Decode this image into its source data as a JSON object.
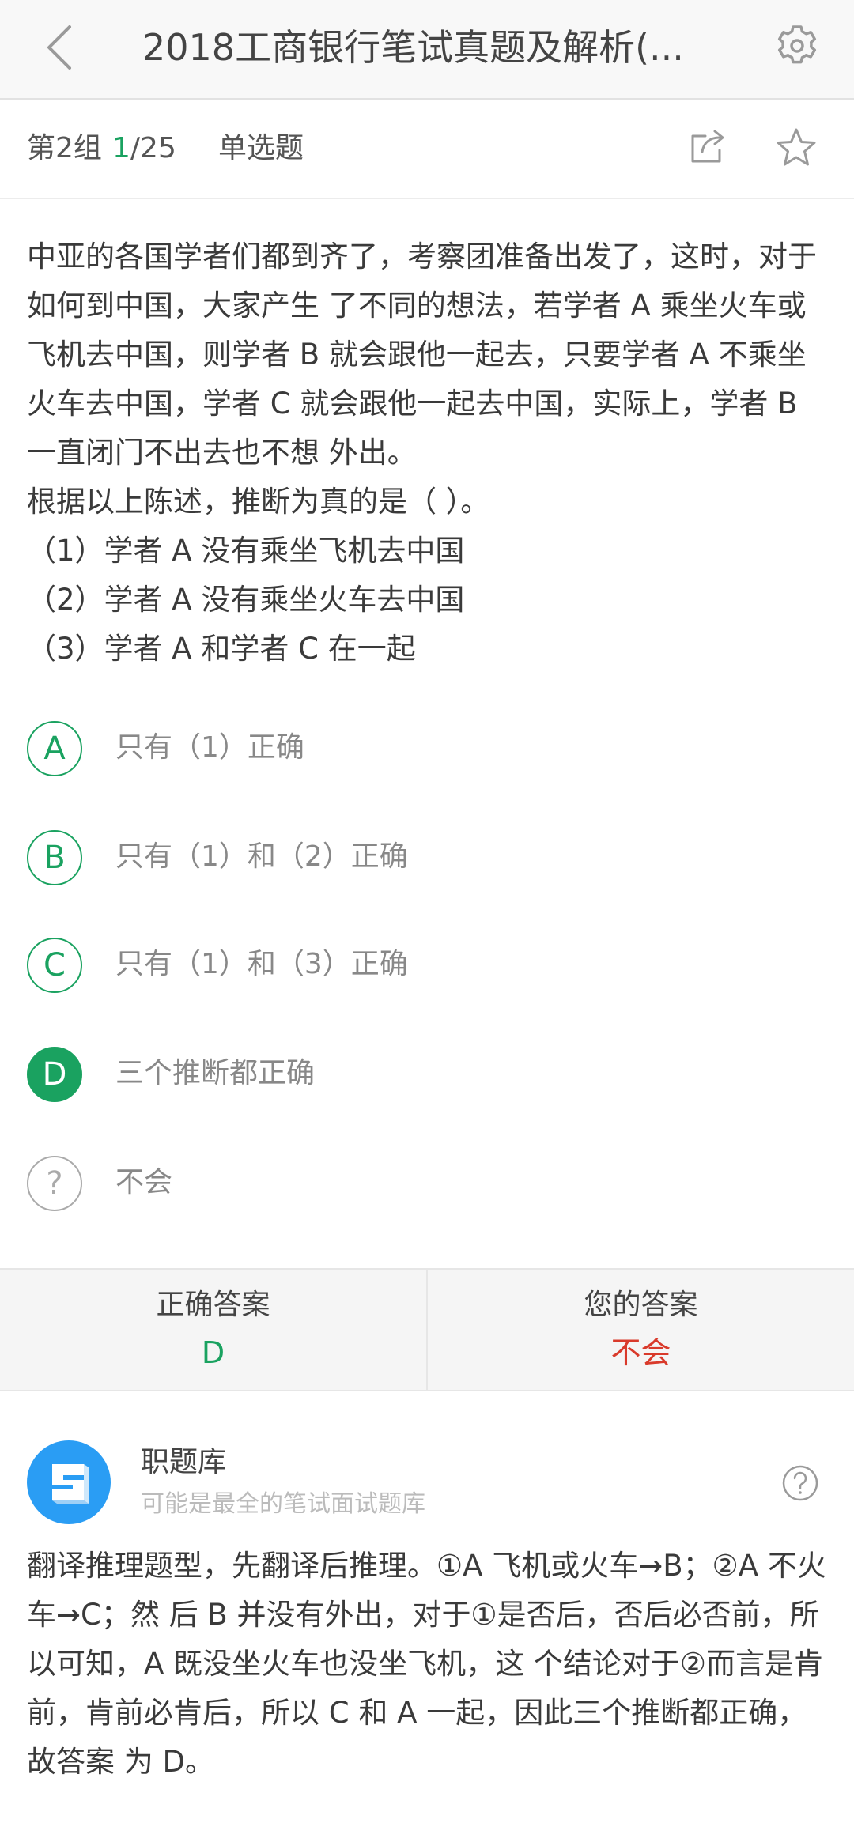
{
  "header": {
    "title": "2018工商银行笔试真题及解析(...",
    "back_icon": "chevron-left-icon",
    "settings_icon": "gear-icon"
  },
  "subbar": {
    "group_label": "第2组",
    "progress_current": "1",
    "progress_total": "/25",
    "question_type": "单选题",
    "share_icon": "share-icon",
    "favorite_icon": "star-icon"
  },
  "question": {
    "lines": [
      "中亚的各国学者们都到齐了，考察团准备出发了，这时，对于如何到中国，大家产生 了不同的想法，若学者 A 乘坐火车或飞机去中国，则学者 B 就会跟他一起去，只要学者 A 不乘坐火车去中国，学者 C 就会跟他一起去中国，实际上，学者 B 一直闭门不出去也不想 外出。",
      "根据以上陈述，推断为真的是（ ）。",
      "（1）学者 A 没有乘坐飞机去中国",
      "（2）学者 A 没有乘坐火车去中国",
      "（3）学者 A 和学者 C 在一起"
    ]
  },
  "options": [
    {
      "letter": "A",
      "text": "只有（1）正确"
    },
    {
      "letter": "B",
      "text": "只有（1）和（2）正确"
    },
    {
      "letter": "C",
      "text": "只有（1）和（3）正确"
    },
    {
      "letter": "D",
      "text": "三个推断都正确"
    },
    {
      "letter": "?",
      "text": "不会"
    }
  ],
  "answer": {
    "correct_label": "正确答案",
    "correct_value": "D",
    "yours_label": "您的答案",
    "yours_value": "不会"
  },
  "source": {
    "name": "职题库",
    "tagline": "可能是最全的笔试面试题库",
    "logo_color": "#2a9df4",
    "help_icon": "question-circle-icon"
  },
  "explanation": "翻译推理题型，先翻译后推理。①A 飞机或火车→B；②A 不火车→C；然 后 B 并没有外出，对于①是否后，否后必否前，所以可知，A 既没坐火车也没坐飞机，这 个结论对于②而言是肯前，肯前必肯后，所以 C 和 A 一起，因此三个推断都正确，故答案 为 D。",
  "colors": {
    "accent": "#1aa260",
    "wrong": "#d93a2b"
  }
}
